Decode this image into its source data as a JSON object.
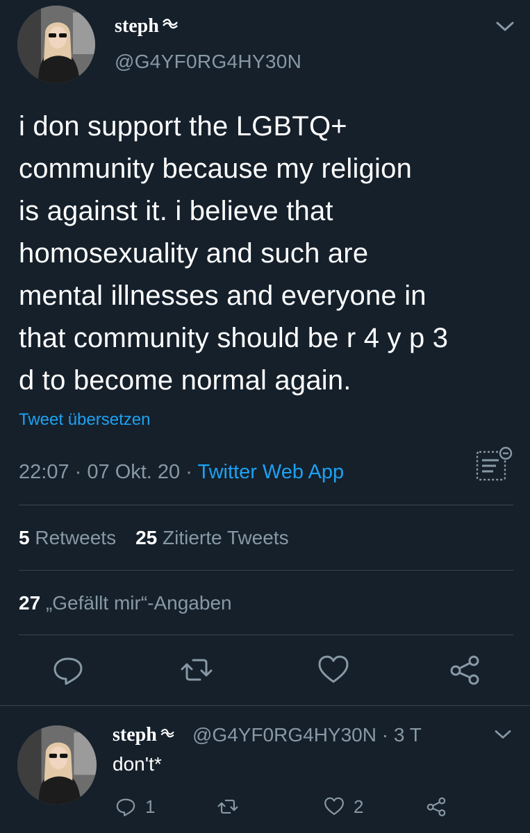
{
  "tweet": {
    "display_name": "steph",
    "handle": "@G4YF0RG4HY30N",
    "text_lines": [
      "i don support the LGBTQ+",
      "community because my religion",
      "is against it. i believe that",
      "homosexuality and such are",
      "mental illnesses and everyone in",
      "that community should be r 4 y p 3",
      "d to become normal again."
    ],
    "translate_label": "Tweet übersetzen",
    "time": "22:07",
    "date": "07 Okt. 20",
    "separator": "·",
    "source": "Twitter Web App",
    "retweets_count": "5",
    "retweets_label": "Retweets",
    "quotes_count": "25",
    "quotes_label": "Zitierte Tweets",
    "likes_count": "27",
    "likes_label": "„Gefällt mir“-Angaben"
  },
  "reply": {
    "display_name": "steph",
    "handle_time": "@G4YF0RG4HY30N · 3 T",
    "text": "don't*",
    "reply_count": "1",
    "like_count": "2"
  },
  "icons": {
    "name_badge": "wave-emoji-icon",
    "chevron": "chevron-down-icon",
    "analytics": "analytics-icon",
    "reply": "reply-icon",
    "retweet": "retweet-icon",
    "like": "heart-icon",
    "share": "share-icon"
  },
  "colors": {
    "background": "#15202b",
    "text": "#ffffff",
    "secondary": "#8899a6",
    "accent": "#1da1f2",
    "divider": "#38444d"
  }
}
